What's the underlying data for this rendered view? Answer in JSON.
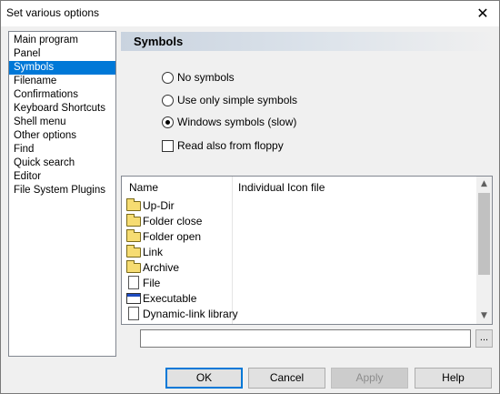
{
  "window": {
    "title": "Set various options",
    "close_glyph": "✕"
  },
  "sidebar": {
    "items": [
      {
        "label": "Main program"
      },
      {
        "label": "Panel"
      },
      {
        "label": "Symbols",
        "selected": true
      },
      {
        "label": "Filename"
      },
      {
        "label": "Confirmations"
      },
      {
        "label": "Keyboard Shortcuts"
      },
      {
        "label": "Shell menu"
      },
      {
        "label": "Other options"
      },
      {
        "label": "Find"
      },
      {
        "label": "Quick search"
      },
      {
        "label": "Editor"
      },
      {
        "label": "File System Plugins"
      }
    ]
  },
  "section": {
    "title": "Symbols"
  },
  "options": {
    "radio_no_symbols": "No symbols",
    "radio_simple_symbols": "Use only simple symbols",
    "radio_windows_symbols": "Windows symbols (slow)",
    "selected_radio": "Windows symbols (slow)",
    "check_floppy": "Read also from floppy",
    "check_floppy_checked": false
  },
  "icon_list": {
    "col_name": "Name",
    "col_file": "Individual Icon file",
    "rows": [
      {
        "label": "Up-Dir",
        "icon": "up-folder-icon"
      },
      {
        "label": "Folder close",
        "icon": "folder-closed-icon"
      },
      {
        "label": "Folder open",
        "icon": "folder-open-icon"
      },
      {
        "label": "Link",
        "icon": "folder-link-icon"
      },
      {
        "label": "Archive",
        "icon": "archive-folder-icon"
      },
      {
        "label": "File",
        "icon": "file-icon"
      },
      {
        "label": "Executable",
        "icon": "executable-icon"
      },
      {
        "label": "Dynamic-link library",
        "icon": "dll-icon"
      }
    ],
    "scroll_up_glyph": "▲",
    "scroll_down_glyph": "▼"
  },
  "path_field": {
    "value": "",
    "browse_label": "..."
  },
  "buttons": {
    "ok": "OK",
    "cancel": "Cancel",
    "apply": "Apply",
    "help": "Help"
  },
  "colors": {
    "selection": "#0078d7",
    "header_gradient_start": "#c9d3df"
  }
}
